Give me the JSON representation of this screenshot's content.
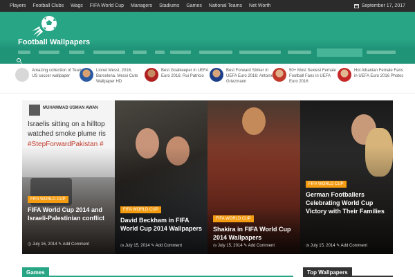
{
  "topnav": {
    "links": [
      "Players",
      "Football Clubs",
      "Wags",
      "FIFA World Cup",
      "Managers",
      "Stadiums",
      "Games",
      "National Teams",
      "Net Worth"
    ],
    "date": "September 17, 2017"
  },
  "site": {
    "title": "Football Wallpapers",
    "accent": "#27a584"
  },
  "recent_posts": [
    {
      "title": "Amazing collection of Team US soccer wallpaper"
    },
    {
      "title": "Lionel Messi, 2016, Barcelona, Messi Cute Wallpaper HD"
    },
    {
      "title": "Best Goalkeeper in UEFA Euro 2016: Rui Patricio"
    },
    {
      "title": "Best Forward Striker in UEFA Euro 2016: Antoine Griezmann"
    },
    {
      "title": "50+ Most Sexiest Female Football Fans in UEFA Euro 2016"
    },
    {
      "title": "Hot Albanian Female Fans in UEFA Euro 2016 Photos"
    }
  ],
  "slides": [
    {
      "category": "FIFA WORLD CUP",
      "title": "FIFA World Cup 2014 and Israeli-Palestinian conflict",
      "date": "July 16, 2014",
      "comment": "Add Comment"
    },
    {
      "category": "FIFA WORLD CUP",
      "title": "David Beckham in FIFA World Cup 2014 Wallpapers",
      "date": "July 15, 2014",
      "comment": "Add Comment"
    },
    {
      "category": "FIFA WORLD CUP",
      "title": "Shakira in FIFA World Cup 2014 Wallpapers",
      "date": "July 15, 2014",
      "comment": "Add Comment"
    },
    {
      "category": "FIFA WORLD CUP",
      "title": "German Footballers Celebrating World Cup Victory with Their Families",
      "date": "July 15, 2014",
      "comment": "Add Comment"
    }
  ],
  "slide1_image": {
    "username": "MUHAMMAD USMAN AWAN",
    "tweet": "Israelis sitting on a hilltop watched smoke plume ris",
    "hashtag": "#StepForwardPakistan #"
  },
  "widgets": {
    "games_label": "Games",
    "top_label": "Top Wallpapers"
  }
}
